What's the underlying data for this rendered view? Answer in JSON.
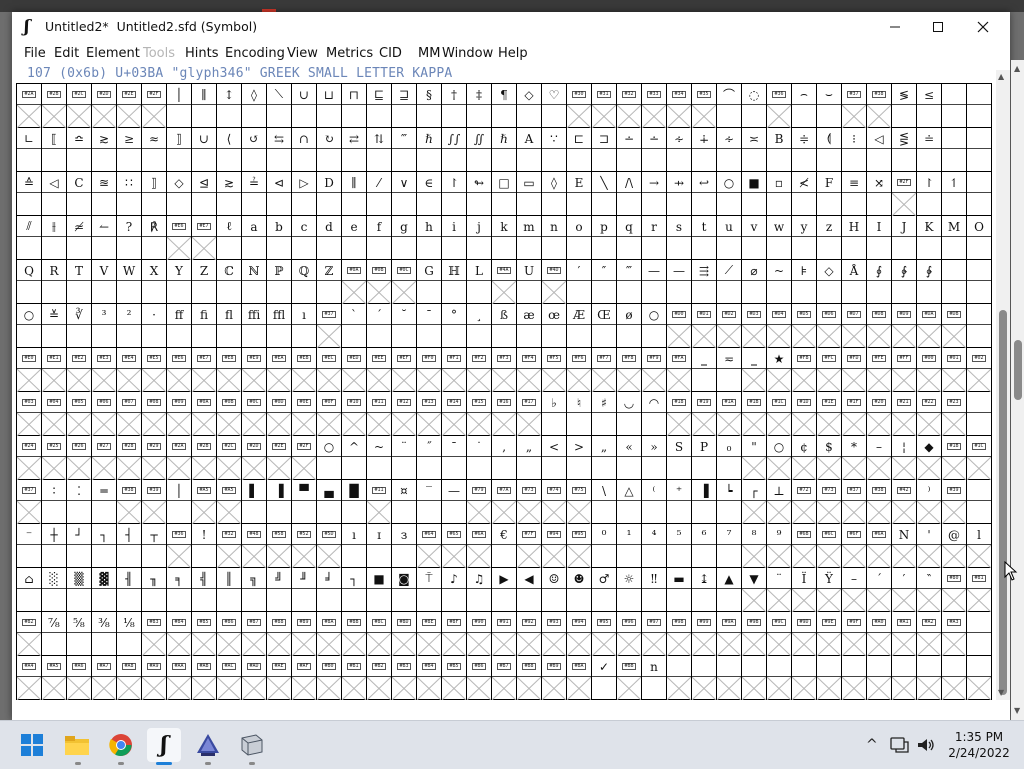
{
  "window": {
    "title": "Untitled2*  Untitled2.sfd (Symbol)",
    "controls": {
      "minimize": "minimize",
      "maximize": "maximize",
      "close": "close"
    }
  },
  "menu": [
    {
      "label": "File",
      "enabled": true
    },
    {
      "label": "Edit",
      "enabled": true
    },
    {
      "label": "Element",
      "enabled": true
    },
    {
      "label": "Tools",
      "enabled": false
    },
    {
      "label": "Hints",
      "enabled": true
    },
    {
      "label": "Encoding",
      "enabled": true
    },
    {
      "label": "View",
      "enabled": true
    },
    {
      "label": "Metrics",
      "enabled": true
    },
    {
      "label": "CID",
      "enabled": true
    },
    {
      "label": "MM",
      "enabled": true
    },
    {
      "label": "Window",
      "enabled": true
    },
    {
      "label": "Help",
      "enabled": true
    }
  ],
  "glyph_info": "107 (0x6b) U+03BA \"glyph346\" GREEK SMALL LETTER KAPPA",
  "grid_rows": [
    [
      "#2A",
      "#2B",
      "#2C",
      "#2D",
      "#2E",
      "#2F",
      "│",
      "∥",
      "↕",
      "◊",
      "⟍",
      "∪",
      "⊔",
      "⊓",
      "⊑",
      "⊒",
      "§",
      "†",
      "‡",
      "¶",
      "◇",
      "♡",
      "#30",
      "#31",
      "#32",
      "#33",
      "#34",
      "#35",
      "⌒",
      "◌",
      "#36",
      "⌢",
      "⌣",
      "#37",
      "#38",
      "≶",
      "≤"
    ],
    [
      "∟",
      "⟦",
      "≏",
      "≳",
      "≥",
      "≈",
      "⟧",
      "∪",
      "⟨",
      "↺",
      "⇆",
      "∩",
      "↻",
      "⇄",
      "⇅",
      "‴",
      "ℏ",
      "∫∫",
      "∬",
      "ℏ",
      "A",
      "∵",
      "⊏",
      "⊐",
      "∸",
      "∸",
      "∻",
      "∔",
      "∻",
      "≍",
      "B",
      "≑",
      "⟬",
      "⁝",
      "◁",
      "⋚",
      "≐"
    ],
    [
      "≙",
      "◁",
      "C",
      "≊",
      "∷",
      "⟧",
      "◇",
      "⊴",
      "≳",
      "≟",
      "⊲",
      "▷",
      "D",
      "∥",
      "⁄",
      "∨",
      "∈",
      "↾",
      "↬",
      "□",
      "▭",
      "◊",
      "E",
      "╲",
      "/\\",
      "→",
      "⇸",
      "↩",
      "○",
      "■",
      "▫",
      "≮",
      "F",
      "≡",
      "⤨",
      "#2F",
      "↾",
      "↿"
    ],
    [
      "⫽",
      "⫲",
      "≄",
      "↼",
      "?",
      "℟",
      "#E6",
      "#E7",
      "ℓ",
      "a",
      "b",
      "c",
      "d",
      "e",
      "f",
      "g",
      "h",
      "i",
      "j",
      "k",
      "m",
      "n",
      "o",
      "p",
      "q",
      "r",
      "s",
      "t",
      "u",
      "v",
      "w",
      "y",
      "z",
      "H",
      "I",
      "J",
      "K",
      "M",
      "O"
    ],
    [
      "Q",
      "R",
      "T",
      "V",
      "W",
      "X",
      "Y",
      "Z",
      "ℂ",
      "ℕ",
      "ℙ",
      "ℚ",
      "ℤ",
      "#0A",
      "#0B",
      "#0C",
      "G",
      "ℍ",
      "L",
      "#4A",
      "U",
      "#4D",
      "′",
      "″",
      "‴",
      "—",
      "—",
      "⇶",
      "⟋",
      "⌀",
      "~",
      "⊧",
      "◇",
      "Å",
      "∮",
      "∲",
      "∳"
    ],
    [
      "○",
      "≚",
      "∛",
      "³",
      "²",
      "·",
      "ff",
      "fi",
      "fl",
      "ffi",
      "ffl",
      "ı",
      "#37",
      "`",
      "´",
      "˘",
      "ˉ",
      "°",
      "¸",
      "ß",
      "æ",
      "œ",
      "Æ",
      "Œ",
      "ø",
      "○",
      "#D0",
      "#D1",
      "#D2",
      "#D3",
      "#D4",
      "#D5",
      "#D6",
      "#D7",
      "#D8",
      "#D9",
      "#DA",
      "#DB"
    ],
    [
      "#E0",
      "#E1",
      "#E2",
      "#E3",
      "#E4",
      "#E5",
      "#E6",
      "#E7",
      "#E8",
      "#E9",
      "#EA",
      "#EB",
      "#EC",
      "#ED",
      "#EE",
      "#EF",
      "#F0",
      "#F1",
      "#F2",
      "#F3",
      "#F4",
      "#F5",
      "#F6",
      "#F7",
      "#F8",
      "#F9",
      "#FA",
      "‗",
      "≂",
      "‗",
      "★",
      "#FB",
      "#FC",
      "#FD",
      "#FE",
      "#FF",
      "#00",
      "#01",
      "#02"
    ],
    [
      "#03",
      "#04",
      "#05",
      "#06",
      "#07",
      "#08",
      "#09",
      "#0A",
      "#0B",
      "#0C",
      "#0D",
      "#0E",
      "#0F",
      "#10",
      "#11",
      "#12",
      "#13",
      "#14",
      "#15",
      "#16",
      "#17",
      "♭",
      "♮",
      "♯",
      "◡",
      "◠",
      "#18",
      "#19",
      "#1A",
      "#1B",
      "#1C",
      "#1D",
      "#1E",
      "#1F",
      "#20",
      "#21",
      "#22",
      "#23"
    ],
    [
      "#24",
      "#25",
      "#26",
      "#27",
      "#28",
      "#29",
      "#2A",
      "#2B",
      "#2C",
      "#2D",
      "#2E",
      "#2F",
      "○",
      "^",
      "~",
      "¨",
      "˝",
      "¯",
      "˙",
      "‚",
      "„",
      "<",
      ">",
      "„",
      "«",
      "»",
      "S",
      "P",
      "₀",
      "\"",
      "○",
      "¢",
      "$",
      "*",
      "–",
      "¦",
      "◆",
      "#1B",
      "#1C"
    ],
    [
      "#37",
      "∶",
      "⁚",
      "═",
      "#38",
      "#39",
      "│",
      "#A5",
      "#A5",
      "▌",
      "▐",
      "▀",
      "▄",
      "█",
      "#11",
      "¤",
      "‾",
      "—",
      "#79",
      "#7A",
      "#73",
      "#74",
      "#75",
      "\\",
      "△",
      "⁽",
      "⁺",
      "▐",
      "┕",
      "┌",
      "⊥",
      "#72",
      "#73",
      "#37",
      "#38",
      "#42",
      "⁾",
      "#39"
    ],
    [
      "⁻",
      "┼",
      "┘",
      "┐",
      "┤",
      "┬",
      "#36",
      "!",
      "#32",
      "#48",
      "#58",
      "#52",
      "#5D",
      "ı",
      "ɪ",
      "з",
      "#64",
      "#65",
      "#6A",
      "€",
      "#7F",
      "#94",
      "#95",
      "⁰",
      "¹",
      "⁴",
      "⁵",
      "⁶",
      "⁷",
      "⁸",
      "⁹",
      "#6B",
      "#6C",
      "#6F",
      "#6A",
      "N",
      "'",
      "@",
      "l"
    ],
    [
      "⌂",
      "░",
      "▒",
      "▓",
      "╢",
      "╖",
      "╕",
      "╣",
      "║",
      "╗",
      "╝",
      "╜",
      "╛",
      "┐",
      "■",
      "◙",
      "⍑",
      "♪",
      "♫",
      "▶",
      "◀",
      "☺",
      "☻",
      "♂",
      "☼",
      "‼",
      "▬",
      "↨",
      "▲",
      "▼",
      "¨",
      "Ï",
      "Ÿ",
      "–",
      "´",
      "′",
      "‶",
      "#80",
      "#81"
    ],
    [
      "#82",
      "⅞",
      "⅝",
      "⅜",
      "⅛",
      "#83",
      "#84",
      "#85",
      "#86",
      "#87",
      "#88",
      "#89",
      "#8A",
      "#8B",
      "#8C",
      "#8D",
      "#8E",
      "#8F",
      "#90",
      "#91",
      "#92",
      "#93",
      "#94",
      "#95",
      "#96",
      "#97",
      "#98",
      "#99",
      "#9A",
      "#9B",
      "#9C",
      "#9D",
      "#9E",
      "#9F",
      "#A0",
      "#A1",
      "#A2",
      "#A3"
    ],
    [
      "#A4",
      "#A5",
      "#A6",
      "#A7",
      "#A8",
      "#A9",
      "#AA",
      "#AB",
      "#AC",
      "#AD",
      "#AE",
      "#AF",
      "#B0",
      "#B1",
      "#B2",
      "#B3",
      "#B4",
      "#B5",
      "#B6",
      "#B7",
      "#B8",
      "#B9",
      "#BA",
      "✓",
      "#BB",
      "n",
      "",
      "",
      "",
      "",
      "",
      "",
      "",
      "",
      "",
      "",
      "",
      "",
      ""
    ]
  ],
  "taskbar": {
    "apps": [
      "start-icon",
      "file-explorer-icon",
      "chrome-icon",
      "fontforge-icon",
      "inkscape-icon",
      "app-icon"
    ],
    "tray": {
      "chevron": "^",
      "time": "1:35 PM",
      "date": "2/24/2022"
    }
  },
  "colors": {
    "glyph_info": "#6b86b8",
    "grid_line": "#000000",
    "empty_cross": "#b8b8b8"
  }
}
